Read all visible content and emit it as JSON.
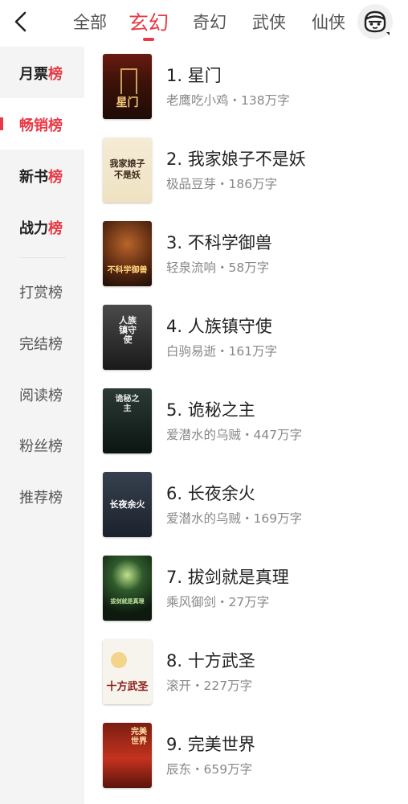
{
  "header": {
    "back_icon": "chevron-left-icon",
    "tabs": [
      {
        "label": "全部",
        "active": false
      },
      {
        "label": "玄幻",
        "active": true
      },
      {
        "label": "奇幻",
        "active": false
      },
      {
        "label": "武侠",
        "active": false
      },
      {
        "label": "仙侠",
        "active": false
      }
    ],
    "avatar_icon": "user-avatar-icon",
    "accent_color": "#e83a46"
  },
  "sidebar": {
    "items": [
      {
        "label_main": "月票",
        "label_end": "榜",
        "active": false
      },
      {
        "label_main": "畅销",
        "label_end": "榜",
        "active": true
      },
      {
        "label_main": "新书",
        "label_end": "榜",
        "active": false
      },
      {
        "label_main": "战力",
        "label_end": "榜",
        "active": false
      },
      {
        "label": "打赏榜"
      },
      {
        "label": "完结榜"
      },
      {
        "label": "阅读榜"
      },
      {
        "label": "粉丝榜"
      },
      {
        "label": "推荐榜"
      }
    ]
  },
  "books": [
    {
      "rank": "1.",
      "title": "星门",
      "author": "老鹰吃小鸡",
      "words": "138万字",
      "cover_text": "星门"
    },
    {
      "rank": "2.",
      "title": "我家娘子不是妖",
      "author": "极品豆芽",
      "words": "186万字",
      "cover_text": "我家娘子不是妖"
    },
    {
      "rank": "3.",
      "title": "不科学御兽",
      "author": "轻泉流响",
      "words": "58万字",
      "cover_text": "不科学御兽"
    },
    {
      "rank": "4.",
      "title": "人族镇守使",
      "author": "白驹易逝",
      "words": "161万字",
      "cover_text": "人族镇守使"
    },
    {
      "rank": "5.",
      "title": "诡秘之主",
      "author": "爱潜水的乌贼",
      "words": "447万字",
      "cover_text": "诡秘之主"
    },
    {
      "rank": "6.",
      "title": "长夜余火",
      "author": "爱潜水的乌贼",
      "words": "169万字",
      "cover_text": "长夜余火"
    },
    {
      "rank": "7.",
      "title": "拔剑就是真理",
      "author": "乘风御剑",
      "words": "27万字",
      "cover_text": "拔剑就是真理"
    },
    {
      "rank": "8.",
      "title": "十方武圣",
      "author": "滚开",
      "words": "227万字",
      "cover_text": "十方武圣"
    },
    {
      "rank": "9.",
      "title": "完美世界",
      "author": "辰东",
      "words": "659万字",
      "cover_text": "完美世界"
    }
  ],
  "meta_separator": "・"
}
